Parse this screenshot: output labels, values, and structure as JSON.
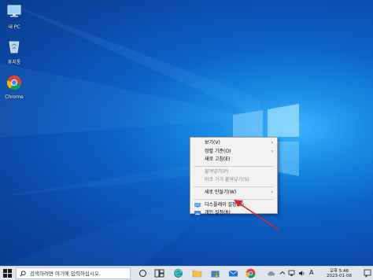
{
  "desktop": {
    "icons": [
      {
        "label": "내 PC",
        "icon": "this-pc-icon"
      },
      {
        "label": "휴지통",
        "icon": "recycle-bin-icon"
      },
      {
        "label": "Chrome",
        "icon": "chrome-icon"
      }
    ]
  },
  "context_menu": {
    "items": [
      {
        "label": "보기(V)",
        "submenu": true,
        "disabled": false
      },
      {
        "label": "정렬 기준(O)",
        "submenu": true,
        "disabled": false
      },
      {
        "label": "새로 고침(E)",
        "submenu": false,
        "disabled": false
      },
      {
        "label": "붙여넣기(P)",
        "submenu": false,
        "disabled": true
      },
      {
        "label": "바로 가기 붙여넣기(S)",
        "submenu": false,
        "disabled": true
      },
      {
        "label": "새로 만들기(W)",
        "submenu": true,
        "disabled": false
      },
      {
        "label": "디스플레이 설정(D)",
        "submenu": false,
        "disabled": false,
        "icon": "display-icon"
      },
      {
        "label": "개인 설정(R)",
        "submenu": false,
        "disabled": false,
        "icon": "personalize-icon"
      }
    ],
    "submenu_glyph": "›"
  },
  "taskbar": {
    "search_placeholder": "검색하려면 여기에 입력하십시오.",
    "apps": [
      "task-view-icon",
      "widgets-icon",
      "edge-icon",
      "file-explorer-icon",
      "store-icon",
      "mail-icon",
      "chrome-icon"
    ],
    "tray": {
      "ime": "A",
      "time": "오후 5:46",
      "date": "2023-01-08"
    }
  },
  "colors": {
    "desktop_accent": "#1a8de6",
    "menu_bg": "#f2f2f2",
    "taskbar_bg": "#dfe5ec",
    "annotation_arrow": "#d9262a"
  }
}
